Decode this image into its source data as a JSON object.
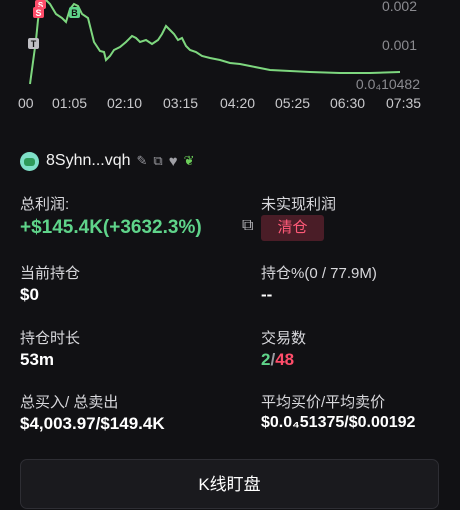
{
  "chart": {
    "y_labels": [
      "0.002",
      "0.001",
      "0.0₄10482"
    ],
    "x_labels": [
      "00",
      "01:05",
      "02:10",
      "03:15",
      "04:20",
      "05:25",
      "06:30",
      "07:35"
    ],
    "markers": [
      "S",
      "S",
      "B",
      "T"
    ],
    "colors": {
      "line": "#7ed77f",
      "sell": "#ff4d6a",
      "buy": "#5fd48a",
      "tag": "#bfbfc4"
    }
  },
  "trader": {
    "name": "8Syhn...vqh"
  },
  "stats": {
    "total_profit_label": "总利润:",
    "total_profit_value": "+$145.4K(+3632.3%)",
    "unrealized_label": "未实现利润",
    "clear_button": "清仓",
    "holding_label": "当前持仓",
    "holding_value": "$0",
    "holding_pct_label": "持仓%(0 / 77.9M)",
    "holding_pct_value": "--",
    "duration_label": "持仓时长",
    "duration_value": "53m",
    "trades_label": "交易数",
    "trades_buys": "2",
    "trades_sep": "/",
    "trades_sells": "48",
    "buy_sell_label": "总买入/ 总卖出",
    "buy_sell_value": "$4,003.97/$149.4K",
    "avg_price_label": "平均买价/平均卖价",
    "avg_price_value": "$0.0₄51375/$0.00192"
  },
  "actions": {
    "kline_button": "K线盯盘"
  }
}
